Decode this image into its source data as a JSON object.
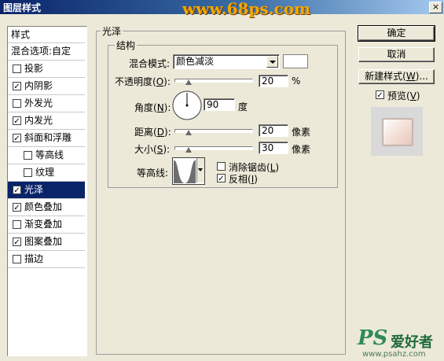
{
  "window": {
    "title": "图层样式",
    "close_label": "×",
    "watermark": "www.68ps.com"
  },
  "styles_panel": {
    "header": "样式",
    "blend_options": "混合选项:自定",
    "items": [
      {
        "label": "投影",
        "checked": false,
        "indent": false,
        "selected": false
      },
      {
        "label": "内阴影",
        "checked": true,
        "indent": false,
        "selected": false
      },
      {
        "label": "外发光",
        "checked": false,
        "indent": false,
        "selected": false
      },
      {
        "label": "内发光",
        "checked": true,
        "indent": false,
        "selected": false
      },
      {
        "label": "斜面和浮雕",
        "checked": true,
        "indent": false,
        "selected": false
      },
      {
        "label": "等高线",
        "checked": false,
        "indent": true,
        "selected": false
      },
      {
        "label": "纹理",
        "checked": false,
        "indent": true,
        "selected": false
      },
      {
        "label": "光泽",
        "checked": true,
        "indent": false,
        "selected": true
      },
      {
        "label": "颜色叠加",
        "checked": true,
        "indent": false,
        "selected": false
      },
      {
        "label": "渐变叠加",
        "checked": false,
        "indent": false,
        "selected": false
      },
      {
        "label": "图案叠加",
        "checked": true,
        "indent": false,
        "selected": false
      },
      {
        "label": "描边",
        "checked": false,
        "indent": false,
        "selected": false
      }
    ]
  },
  "satin": {
    "title": "光泽",
    "structure_title": "结构",
    "blend_mode_label": "混合模式:",
    "blend_mode_value": "颜色减淡",
    "opacity_label_pre": "不透明度(",
    "opacity_key": "O",
    "opacity_label_post": "):",
    "opacity_value": "20",
    "opacity_unit": "%",
    "angle_label_pre": "角度(",
    "angle_key": "N",
    "angle_label_post": "):",
    "angle_value": "90",
    "angle_unit": "度",
    "distance_label_pre": "距离(",
    "distance_key": "D",
    "distance_label_post": "):",
    "distance_value": "20",
    "distance_unit": "像素",
    "size_label_pre": "大小(",
    "size_key": "S",
    "size_label_post": "):",
    "size_value": "30",
    "size_unit": "像素",
    "contour_label": "等高线:",
    "anti_alias_label_pre": "消除锯齿(",
    "anti_alias_key": "L",
    "anti_alias_label_post": ")",
    "anti_alias_checked": false,
    "invert_label_pre": "反相(",
    "invert_key": "I",
    "invert_label_post": ")",
    "invert_checked": true
  },
  "buttons": {
    "ok": "确定",
    "cancel": "取消",
    "new_style_pre": "新建样式(",
    "new_style_key": "W",
    "new_style_post": ")...",
    "preview_pre": "预览(",
    "preview_key": "V",
    "preview_post": ")",
    "preview_checked": true
  },
  "footer_watermark": {
    "logo": "PS",
    "cn": "爱好者",
    "url": "www.psahz.com"
  }
}
